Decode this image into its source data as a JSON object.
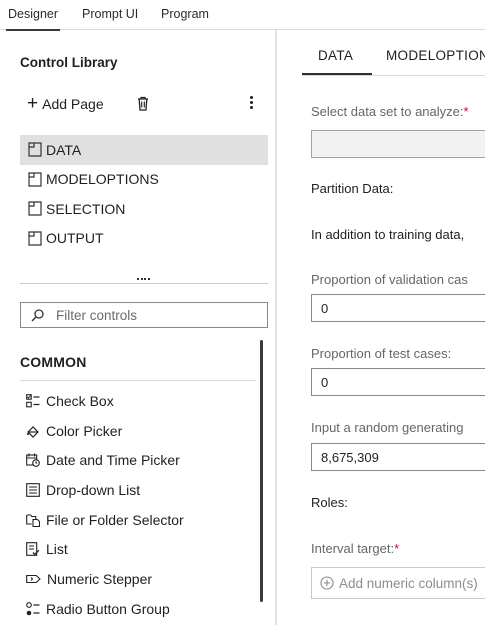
{
  "top_tabs": [
    "Designer",
    "Prompt UI",
    "Program"
  ],
  "library": {
    "title": "Control Library",
    "add_page_label": "Add Page",
    "pages": [
      "DATA",
      "MODELOPTIONS",
      "SELECTION",
      "OUTPUT"
    ],
    "filter_placeholder": "Filter controls",
    "section_title": "COMMON",
    "controls": [
      "Check Box",
      "Color Picker",
      "Date and Time Picker",
      "Drop-down List",
      "File or Folder Selector",
      "List",
      "Numeric Stepper",
      "Radio Button Group"
    ]
  },
  "designer": {
    "tabs": [
      "DATA",
      "MODELOPTION"
    ],
    "dataset_label": "Select data set to analyze:",
    "required_mark": "*",
    "partition_label": "Partition Data:",
    "partition_text": "In addition to training data,",
    "validation_label": "Proportion of validation cas",
    "validation_value": "0",
    "test_label": "Proportion of test cases:",
    "test_value": "0",
    "seed_label": "Input a random generating",
    "seed_value": "8,675,309",
    "roles_label": "Roles:",
    "interval_label": "Interval target:",
    "add_column_label": "Add numeric column(s)"
  },
  "colors": {
    "selected_row": "#e0e0e0",
    "required": "#c8102e",
    "accent": "#2f2f2f"
  }
}
